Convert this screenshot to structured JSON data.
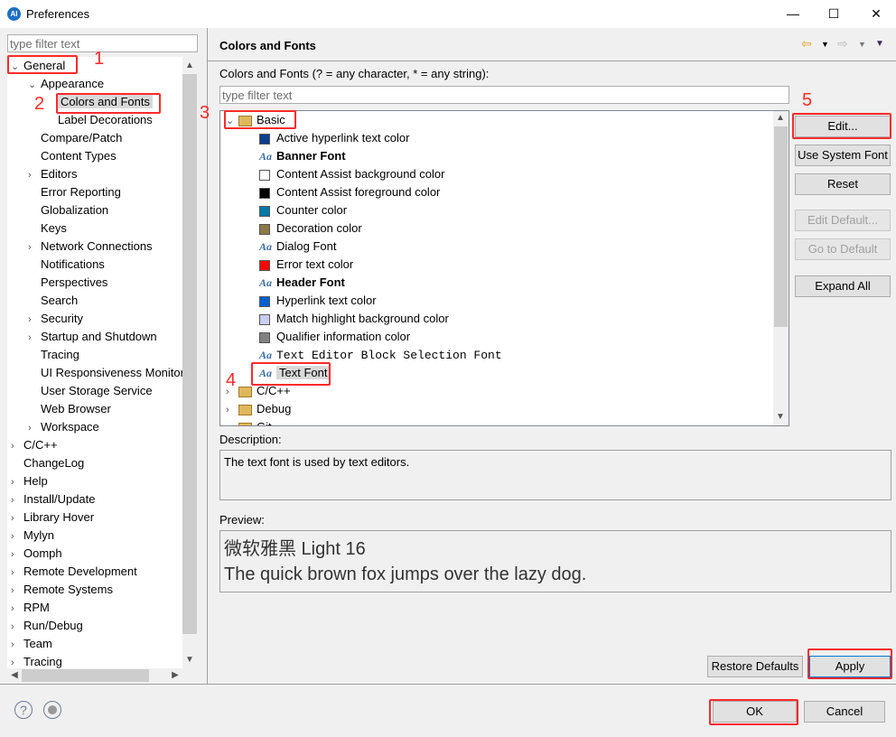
{
  "window": {
    "title": "Preferences",
    "app_icon": "AI"
  },
  "left": {
    "filter_placeholder": "type filter text",
    "tree": [
      {
        "label": "General",
        "level": 0,
        "expander": "expanded"
      },
      {
        "label": "Appearance",
        "level": 1,
        "expander": "expanded"
      },
      {
        "label": "Colors and Fonts",
        "level": 2,
        "expander": "none",
        "selected": true
      },
      {
        "label": "Label Decorations",
        "level": 2,
        "expander": "none"
      },
      {
        "label": "Compare/Patch",
        "level": 1,
        "expander": "none"
      },
      {
        "label": "Content Types",
        "level": 1,
        "expander": "none"
      },
      {
        "label": "Editors",
        "level": 1,
        "expander": "collapsed"
      },
      {
        "label": "Error Reporting",
        "level": 1,
        "expander": "none"
      },
      {
        "label": "Globalization",
        "level": 1,
        "expander": "none"
      },
      {
        "label": "Keys",
        "level": 1,
        "expander": "none"
      },
      {
        "label": "Network Connections",
        "level": 1,
        "expander": "collapsed"
      },
      {
        "label": "Notifications",
        "level": 1,
        "expander": "none"
      },
      {
        "label": "Perspectives",
        "level": 1,
        "expander": "none"
      },
      {
        "label": "Search",
        "level": 1,
        "expander": "none"
      },
      {
        "label": "Security",
        "level": 1,
        "expander": "collapsed"
      },
      {
        "label": "Startup and Shutdown",
        "level": 1,
        "expander": "collapsed"
      },
      {
        "label": "Tracing",
        "level": 1,
        "expander": "none"
      },
      {
        "label": "UI Responsiveness Monitoring",
        "level": 1,
        "expander": "none"
      },
      {
        "label": "User Storage Service",
        "level": 1,
        "expander": "none"
      },
      {
        "label": "Web Browser",
        "level": 1,
        "expander": "none"
      },
      {
        "label": "Workspace",
        "level": 1,
        "expander": "collapsed"
      },
      {
        "label": "C/C++",
        "level": 0,
        "expander": "collapsed"
      },
      {
        "label": "ChangeLog",
        "level": 0,
        "expander": "none"
      },
      {
        "label": "Help",
        "level": 0,
        "expander": "collapsed"
      },
      {
        "label": "Install/Update",
        "level": 0,
        "expander": "collapsed"
      },
      {
        "label": "Library Hover",
        "level": 0,
        "expander": "collapsed"
      },
      {
        "label": "Mylyn",
        "level": 0,
        "expander": "collapsed"
      },
      {
        "label": "Oomph",
        "level": 0,
        "expander": "collapsed"
      },
      {
        "label": "Remote Development",
        "level": 0,
        "expander": "collapsed"
      },
      {
        "label": "Remote Systems",
        "level": 0,
        "expander": "collapsed"
      },
      {
        "label": "RPM",
        "level": 0,
        "expander": "collapsed"
      },
      {
        "label": "Run/Debug",
        "level": 0,
        "expander": "collapsed"
      },
      {
        "label": "Team",
        "level": 0,
        "expander": "collapsed"
      },
      {
        "label": "Tracing",
        "level": 0,
        "expander": "collapsed"
      }
    ]
  },
  "main": {
    "title": "Colors and Fonts",
    "filter_label": "Colors and Fonts (? = any character, * = any string):",
    "filter_placeholder": "type filter text",
    "tree": [
      {
        "label": "Basic",
        "type": "category",
        "expander": "expanded"
      },
      {
        "label": "Active hyperlink text color",
        "type": "color",
        "color": "#0b3d91"
      },
      {
        "label": "Banner Font",
        "type": "font",
        "bold": true
      },
      {
        "label": "Content Assist background color",
        "type": "color",
        "color": "#ffffff"
      },
      {
        "label": "Content Assist foreground color",
        "type": "color",
        "color": "#000000"
      },
      {
        "label": "Counter color",
        "type": "color",
        "color": "#0079a8"
      },
      {
        "label": "Decoration color",
        "type": "color",
        "color": "#8c7849"
      },
      {
        "label": "Dialog Font",
        "type": "font"
      },
      {
        "label": "Error text color",
        "type": "color",
        "color": "#ff0000"
      },
      {
        "label": "Header Font",
        "type": "font",
        "bold": true
      },
      {
        "label": "Hyperlink text color",
        "type": "color",
        "color": "#0060d0"
      },
      {
        "label": "Match highlight background color",
        "type": "color",
        "color": "#ccccf5"
      },
      {
        "label": "Qualifier information color",
        "type": "color",
        "color": "#808080"
      },
      {
        "label": "Text Editor Block Selection Font",
        "type": "font",
        "mono": true
      },
      {
        "label": "Text Font",
        "type": "font",
        "selected": true
      },
      {
        "label": "C/C++",
        "type": "category",
        "expander": "collapsed"
      },
      {
        "label": "Debug",
        "type": "category",
        "expander": "collapsed"
      },
      {
        "label": "Git",
        "type": "category",
        "expander": "collapsed"
      }
    ],
    "buttons": {
      "edit": "Edit...",
      "use_system_font": "Use System Font",
      "reset": "Reset",
      "edit_default": "Edit Default...",
      "go_to_default": "Go to Default",
      "expand_all": "Expand All"
    },
    "description_label": "Description:",
    "description": "The text font is used by text editors.",
    "preview_label": "Preview:",
    "preview_line1": "微软雅黑 Light 16",
    "preview_line2": "The quick brown fox jumps over the lazy dog.",
    "restore_defaults": "Restore Defaults",
    "apply": "Apply"
  },
  "footer": {
    "ok": "OK",
    "cancel": "Cancel",
    "help_icon": "?"
  },
  "annotations": [
    "1",
    "2",
    "3",
    "4",
    "5"
  ],
  "colors": {
    "annotation": "#ff2a2a",
    "selection": "#d9d9d9"
  }
}
